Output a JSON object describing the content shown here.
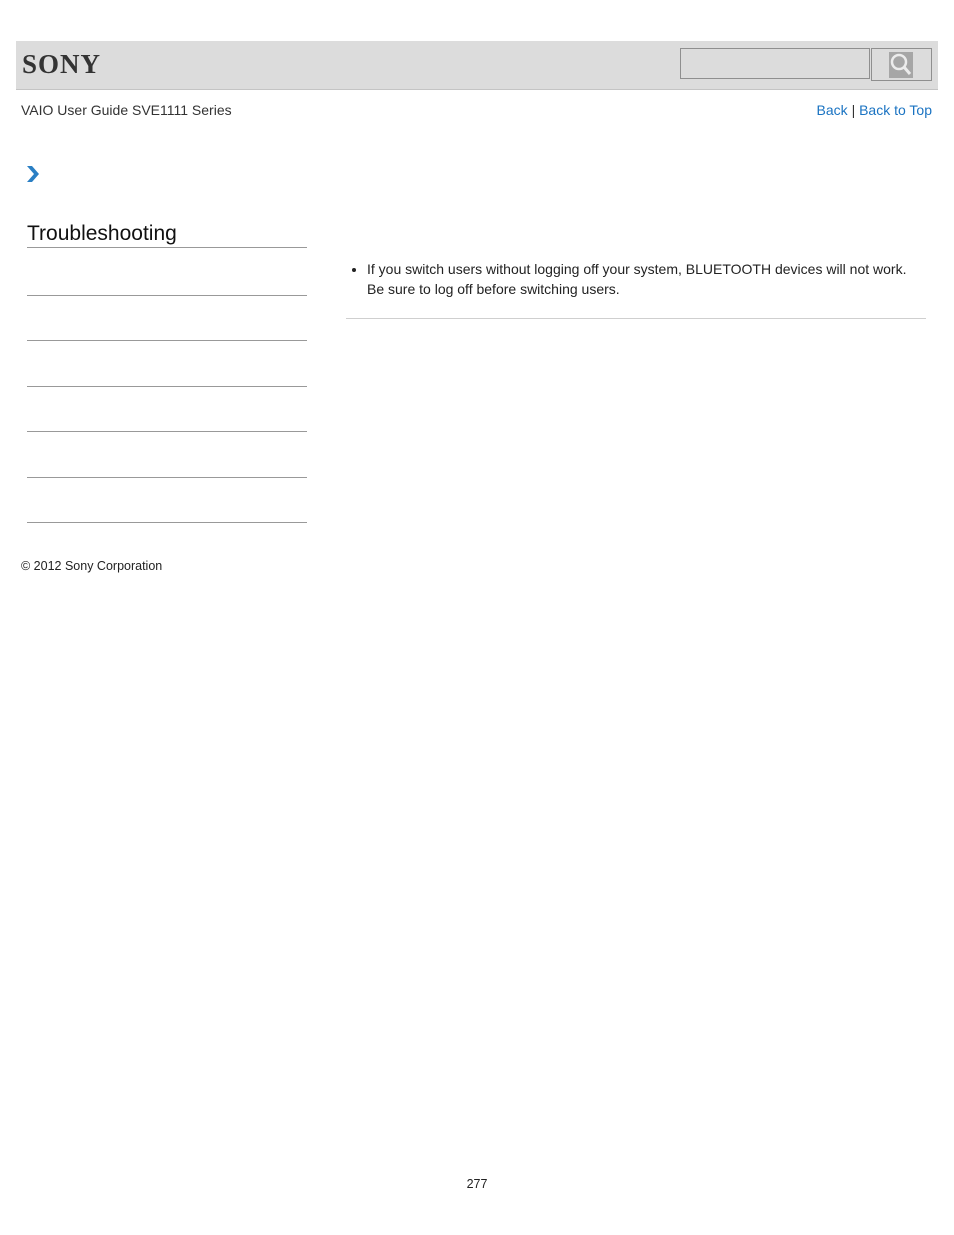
{
  "header": {
    "logo": "SONY",
    "search": {
      "value": "",
      "placeholder": ""
    },
    "search_icon": "magnifier-icon"
  },
  "subheader": {
    "guide_title": "VAIO User Guide SVE1111 Series",
    "back_label": "Back",
    "separator": "|",
    "back_to_top_label": "Back to Top"
  },
  "breadcrumb": {
    "icon": "chevron-right-icon",
    "accent_color": "#2a7fc4"
  },
  "sidebar": {
    "title": "Troubleshooting",
    "items": [
      "",
      "",
      "",
      "",
      "",
      ""
    ]
  },
  "content": {
    "bullets": [
      "If you switch users without logging off your system, BLUETOOTH devices will not work. Be sure to log off before switching users."
    ]
  },
  "footer": {
    "copyright": "© 2012 Sony Corporation",
    "page_number": "277"
  }
}
